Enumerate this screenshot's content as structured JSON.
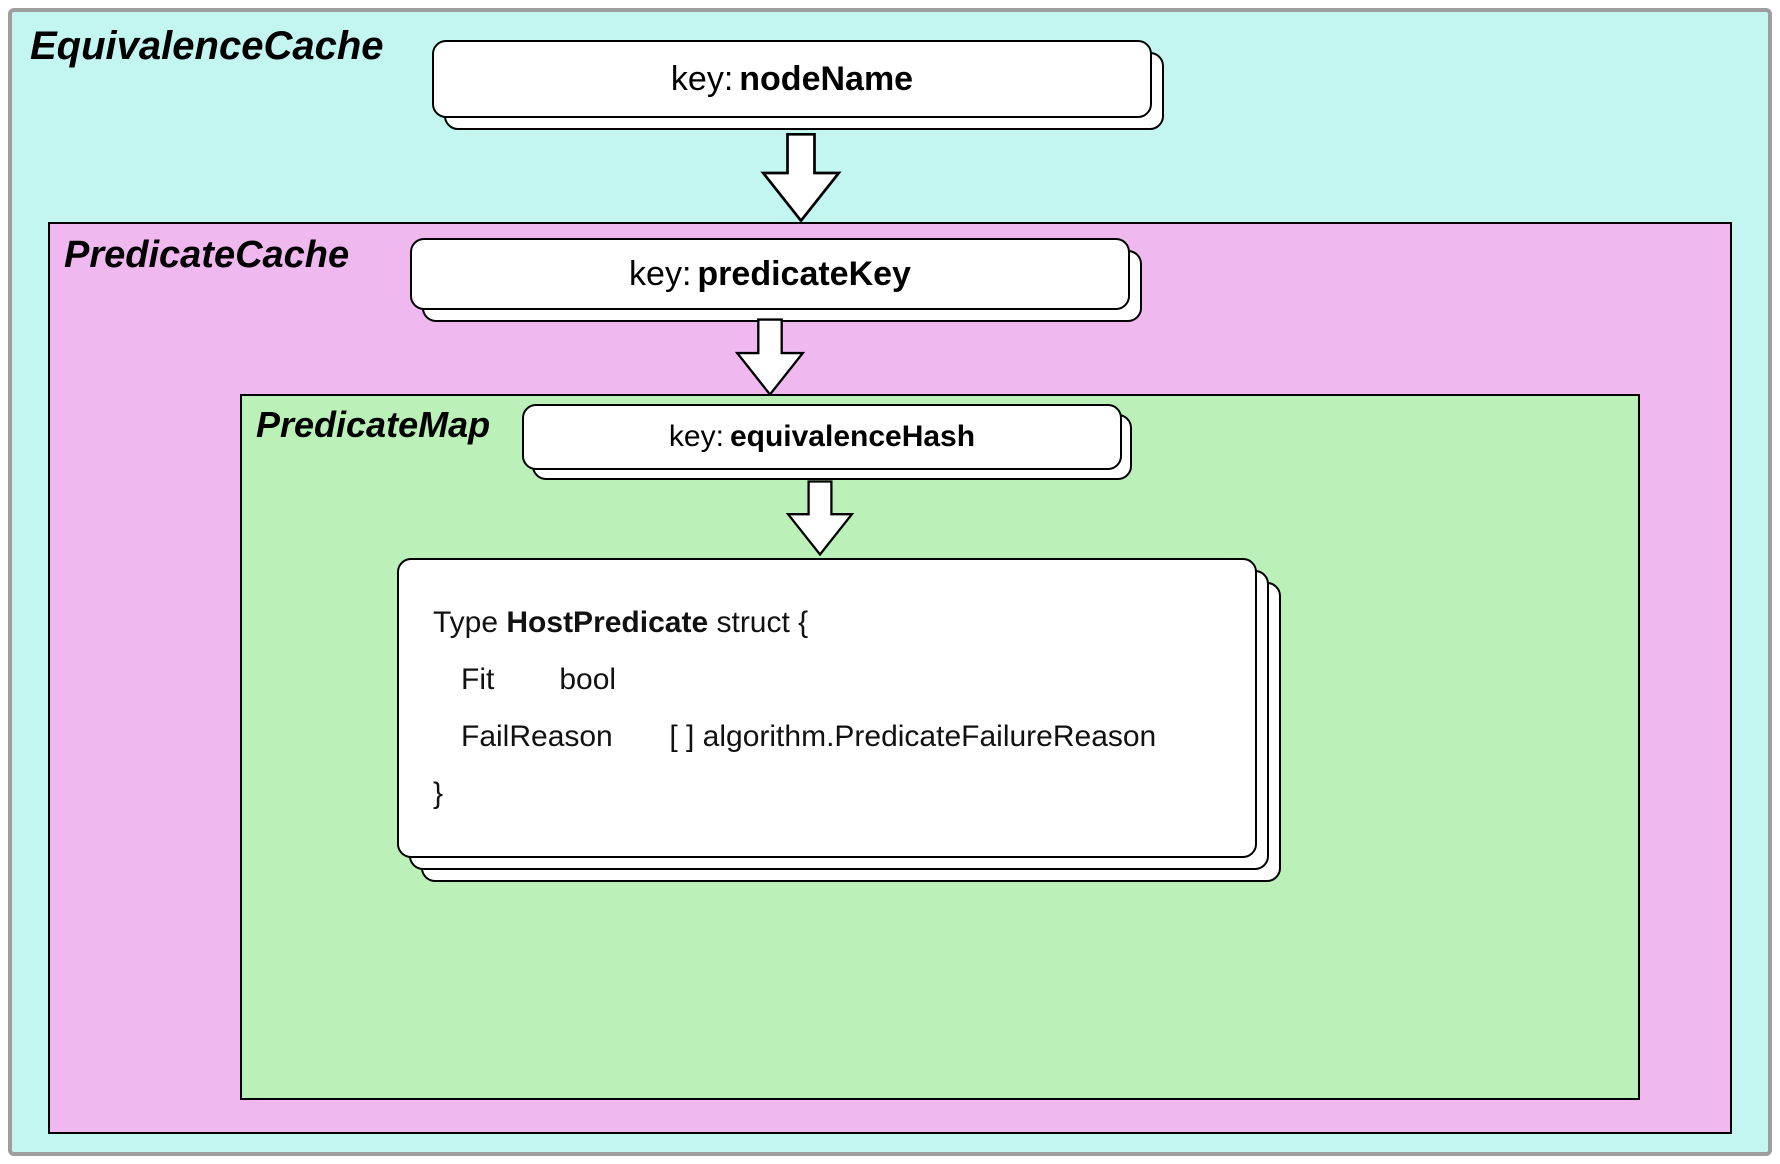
{
  "outer": {
    "title": "EquivalenceCache",
    "key_label": "key:",
    "key_value": "nodeName"
  },
  "mid": {
    "title": "PredicateCache",
    "key_label": "key:",
    "key_value": "predicateKey"
  },
  "inner": {
    "title": "PredicateMap",
    "key_label": "key:",
    "key_value": "equivalenceHash"
  },
  "struct": {
    "type_kw": "Type",
    "name": "HostPredicate",
    "struct_kw": "struct {",
    "field1_name": "Fit",
    "field1_type": "bool",
    "field2_name": "FailReason",
    "field2_type": "[ ] algorithm.PredicateFailureReason",
    "close": "}"
  }
}
